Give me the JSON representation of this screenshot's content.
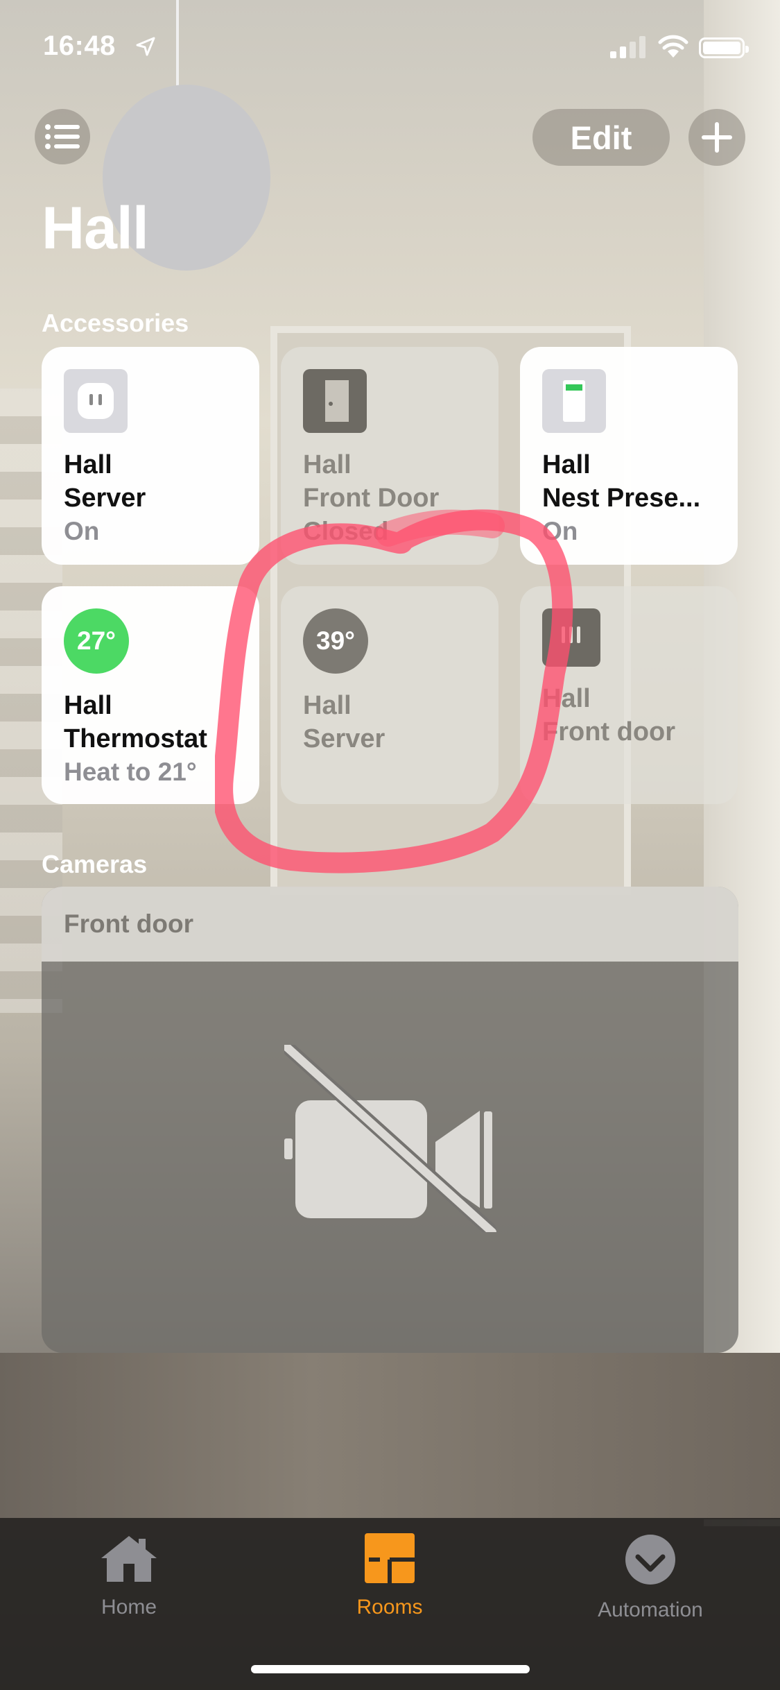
{
  "status_bar": {
    "time": "16:48"
  },
  "header": {
    "edit_label": "Edit",
    "title": "Hall"
  },
  "sections": {
    "accessories": "Accessories",
    "cameras": "Cameras"
  },
  "accessories": [
    {
      "room": "Hall",
      "name": "Server",
      "status": "On",
      "icon": "outlet-icon",
      "state": "on"
    },
    {
      "room": "Hall",
      "name": "Front Door",
      "status": "Closed",
      "icon": "door-icon",
      "state": "off"
    },
    {
      "room": "Hall",
      "name": "Nest Prese...",
      "status": "On",
      "icon": "sensor-icon",
      "state": "on"
    },
    {
      "room": "Hall",
      "name": "Thermostat",
      "status": "Heat to 21°",
      "temp": "27°",
      "icon": "thermostat-icon",
      "state": "on"
    },
    {
      "room": "Hall",
      "name": "Server",
      "temp": "39°",
      "icon": "temperature-sensor-icon",
      "state": "off"
    },
    {
      "room": "Hall",
      "name": "Front door",
      "icon": "doorbell-icon",
      "state": "off"
    }
  ],
  "camera": {
    "name": "Front door",
    "icon": "video-off-icon"
  },
  "tab_bar": {
    "tabs": [
      {
        "label": "Home",
        "icon": "house-icon",
        "active": false
      },
      {
        "label": "Rooms",
        "icon": "rooms-icon",
        "active": true
      },
      {
        "label": "Automation",
        "icon": "automation-icon",
        "active": false
      }
    ]
  },
  "colors": {
    "accent": "#f7971c",
    "thermostat_heat": "#4cd964",
    "annotation": "#ff4f6e"
  }
}
